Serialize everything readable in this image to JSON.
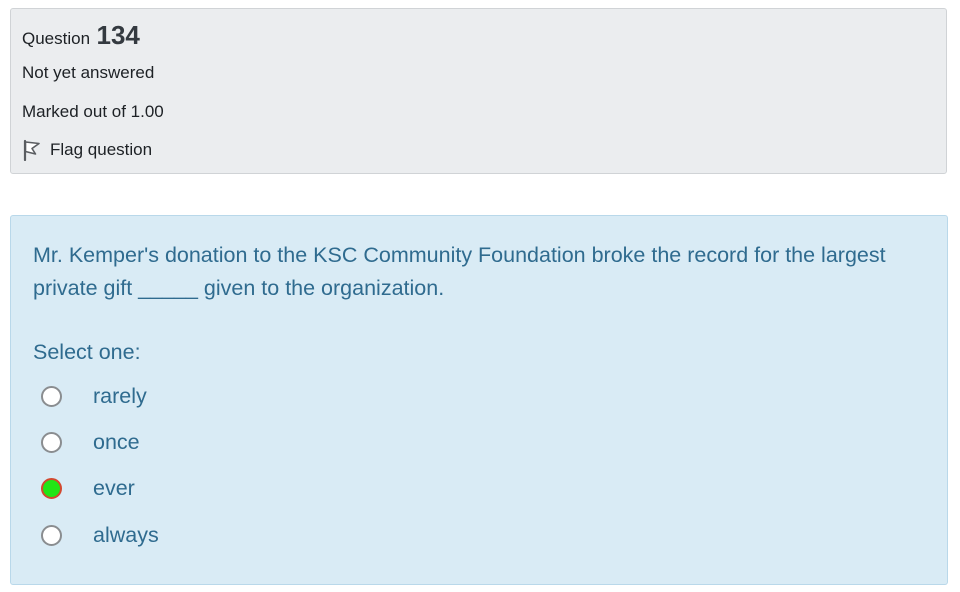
{
  "info": {
    "question_label": "Question",
    "question_number": "134",
    "state": "Not yet answered",
    "grade": "Marked out of 1.00",
    "flag_label": "Flag question",
    "flag_icon": "flag-icon"
  },
  "question": {
    "text": "Mr. Kemper's donation to the KSC Community Foundation broke the record for the largest private gift _____ given to the organization.",
    "prompt": "Select one:",
    "options": [
      {
        "label": "rarely",
        "selected": false
      },
      {
        "label": "once",
        "selected": false
      },
      {
        "label": "ever",
        "selected": true
      },
      {
        "label": "always",
        "selected": false
      }
    ]
  },
  "colors": {
    "info_background": "#ebedef",
    "formulation_background": "#d9ebf5",
    "question_text": "#2f6b8f",
    "selected_radio_fill": "#22e515",
    "selected_radio_border": "#d2492f"
  }
}
